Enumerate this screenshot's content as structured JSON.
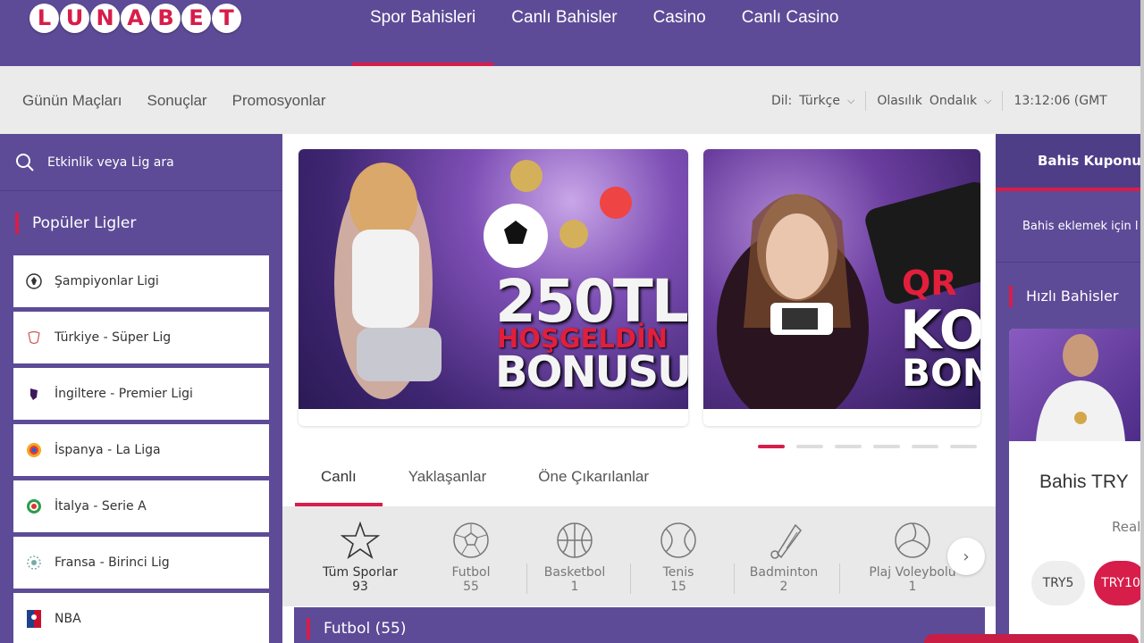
{
  "brand": {
    "logo_letters": [
      "L",
      "U",
      "N",
      "A",
      "B",
      "E",
      "T"
    ],
    "primary": "#5d4b97",
    "accent": "#d71d4a"
  },
  "main_nav": [
    {
      "label": "Spor Bahisleri",
      "active": true
    },
    {
      "label": "Canlı Bahisler"
    },
    {
      "label": "Casino"
    },
    {
      "label": "Canlı Casino"
    }
  ],
  "sub_nav": [
    "Günün Maçları",
    "Sonuçlar",
    "Promosyonlar"
  ],
  "settings": {
    "lang_label": "Dil:",
    "lang_value": "Türkçe",
    "odds_label": "Olasılık",
    "odds_value": "Ondalık",
    "time": "13:12:06 (GMT"
  },
  "left_sidebar": {
    "search_placeholder": "Etkinlik veya Lig ara",
    "popular_title": "Popüler Ligler",
    "leagues": [
      {
        "name": "Şampiyonlar Ligi",
        "icon": "champions-league-icon"
      },
      {
        "name": "Türkiye - Süper Lig",
        "icon": "super-lig-icon"
      },
      {
        "name": "İngiltere - Premier Ligi",
        "icon": "premier-league-icon"
      },
      {
        "name": "İspanya - La Liga",
        "icon": "la-liga-icon"
      },
      {
        "name": "İtalya - Serie A",
        "icon": "serie-a-icon"
      },
      {
        "name": "Fransa - Birinci Lig",
        "icon": "ligue-1-icon"
      },
      {
        "name": "NBA",
        "icon": "nba-icon"
      }
    ]
  },
  "banners": [
    {
      "line1": "250TL",
      "line2": "HOŞGELDİN",
      "line3": "BONUSU"
    },
    {
      "line1": "QR",
      "line2": "KO",
      "line3": "BON"
    }
  ],
  "carousel": {
    "count": 6,
    "active": 0
  },
  "content_tabs": [
    {
      "label": "Canlı",
      "active": true
    },
    {
      "label": "Yaklaşanlar"
    },
    {
      "label": "Öne Çıkarılanlar"
    }
  ],
  "sports": [
    {
      "name": "Tüm Sporlar",
      "count": "93",
      "icon": "star-icon",
      "active": true
    },
    {
      "name": "Futbol",
      "count": "55",
      "icon": "football-icon"
    },
    {
      "name": "Basketbol",
      "count": "1",
      "icon": "basketball-icon"
    },
    {
      "name": "Tenis",
      "count": "15",
      "icon": "tennis-icon"
    },
    {
      "name": "Badminton",
      "count": "2",
      "icon": "badminton-icon"
    },
    {
      "name": "Plaj Voleybolu",
      "count": "1",
      "icon": "volleyball-icon"
    }
  ],
  "section_header": "Futbol (55)",
  "right_sidebar": {
    "coupon_title": "Bahis Kuponu",
    "coupon_msg": "Bahis eklemek için l",
    "quick_title": "Hızlı Bahisler",
    "card_title": "Bahis TRY",
    "card_sub": "Real",
    "pills": [
      "TRY5",
      "TRY10"
    ]
  }
}
